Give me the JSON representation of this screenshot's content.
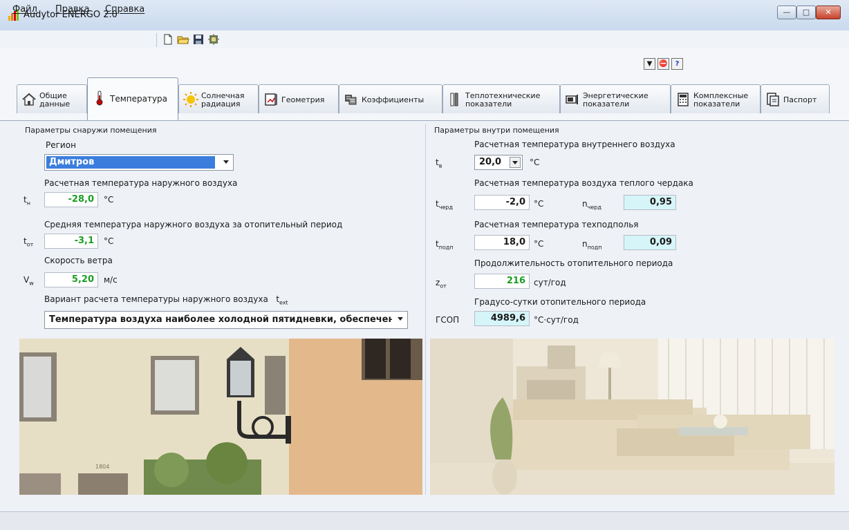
{
  "window": {
    "title": "Audytor ENERGO 2.0"
  },
  "menu": {
    "file": "Файл",
    "edit": "Правка",
    "help": "Справка"
  },
  "toolbar_icons": [
    "new-file-icon",
    "open-folder-icon",
    "save-icon",
    "settings-icon"
  ],
  "top_buttons": [
    "dropdown-icon",
    "stop-icon",
    "help-icon"
  ],
  "help_label": "?",
  "tabs": [
    {
      "line1": "Общие",
      "line2": "данные",
      "icon": "home-icon"
    },
    {
      "line1": "Температура",
      "line2": "",
      "icon": "thermometer-icon"
    },
    {
      "line1": "Солнечная",
      "line2": "радиация",
      "icon": "sun-icon"
    },
    {
      "line1": "Геометрия",
      "line2": "",
      "icon": "geometry-icon"
    },
    {
      "line1": "Коэффициенты",
      "line2": "",
      "icon": "coefficients-icon"
    },
    {
      "line1": "Теплотехнические",
      "line2": "показатели",
      "icon": "thermal-icon"
    },
    {
      "line1": "Энергетические",
      "line2": "показатели",
      "icon": "energy-icon"
    },
    {
      "line1": "Комплексные",
      "line2": "показатели",
      "icon": "calculator-icon"
    },
    {
      "line1": "Паспорт",
      "line2": "",
      "icon": "passport-icon"
    }
  ],
  "outside": {
    "group_title": "Параметры снаружи помещения",
    "region_label": "Регион",
    "region_value": "Дмитров",
    "t_design_label": "Расчетная температура наружного воздуха",
    "t_design_sym": "t",
    "t_design_sub": "н",
    "t_design_value": "-28,0",
    "t_design_unit": "°C",
    "t_avg_label": "Средняя температура наружного воздуха за отопительный период",
    "t_avg_sym": "t",
    "t_avg_sub": "от",
    "t_avg_value": "-3,1",
    "t_avg_unit": "°C",
    "wind_label": "Скорость ветра",
    "wind_sym": "V",
    "wind_sub": "w",
    "wind_value": "5,20",
    "wind_unit": "м/с",
    "variant_label": "Вариант расчета температуры наружного воздуха",
    "variant_sym": "t",
    "variant_sub": "ext",
    "variant_value": "Температура воздуха наиболее холодной пятидневки, обеспечен"
  },
  "inside": {
    "group_title": "Параметры внутри помещения",
    "t_int_label": "Расчетная температура внутреннего воздуха",
    "t_int_sym": "t",
    "t_int_sub": "в",
    "t_int_value": "20,0",
    "t_int_unit": "°C",
    "t_attic_label": "Расчетная температура воздуха теплого чердака",
    "t_attic_sym": "t",
    "t_attic_sub": "черд",
    "t_attic_value": "-2,0",
    "t_attic_unit": "°C",
    "n_attic_sym": "n",
    "n_attic_sub": "черд",
    "n_attic_value": "0,95",
    "t_under_label": "Расчетная температура техподполья",
    "t_under_sym": "t",
    "t_under_sub": "подп",
    "t_under_value": "18,0",
    "t_under_unit": "°C",
    "n_under_sym": "n",
    "n_under_sub": "подп",
    "n_under_value": "0,09",
    "period_label": "Продолжительность отопительного периода",
    "period_sym": "z",
    "period_sub": "от",
    "period_value": "216",
    "period_unit": "сут/год",
    "gsop_label": "Градусо-сутки отопительного периода",
    "gsop_sym": "ГСОП",
    "gsop_value": "4989,6",
    "gsop_unit": "°C·сут/год"
  },
  "photos": {
    "left_caption": "1804"
  }
}
